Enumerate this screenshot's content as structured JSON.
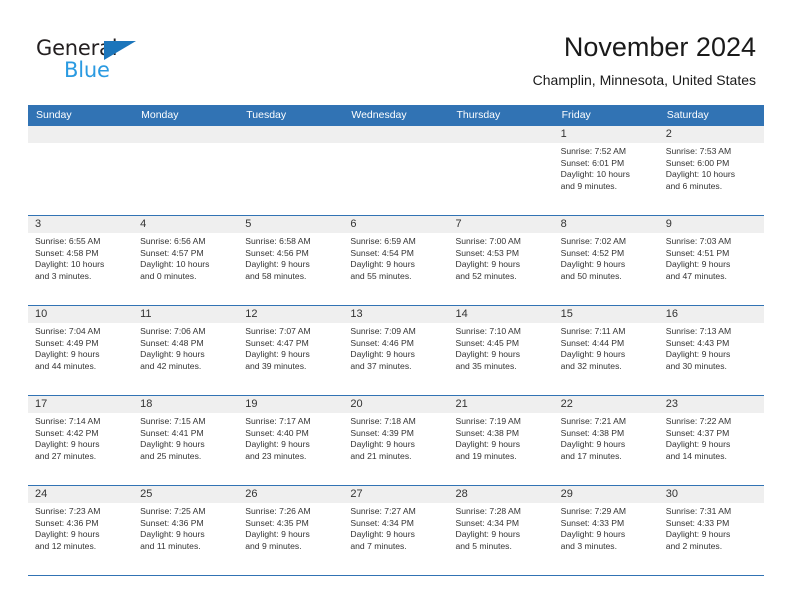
{
  "brand": {
    "name_part1": "General",
    "name_part2": "Blue",
    "triangle_color": "#1b75bb",
    "blue_text_color": "#2a9ae1"
  },
  "header": {
    "title": "November 2024",
    "subtitle": "Champlin, Minnesota, United States"
  },
  "colors": {
    "header_blue": "#3173b4",
    "daynum_band": "#efefef",
    "text": "#333333"
  },
  "weekdays": [
    "Sunday",
    "Monday",
    "Tuesday",
    "Wednesday",
    "Thursday",
    "Friday",
    "Saturday"
  ],
  "weeks": [
    [
      {
        "day": "",
        "empty": true,
        "sunrise": "",
        "sunset": "",
        "daylight1": "",
        "daylight2": ""
      },
      {
        "day": "",
        "empty": true,
        "sunrise": "",
        "sunset": "",
        "daylight1": "",
        "daylight2": ""
      },
      {
        "day": "",
        "empty": true,
        "sunrise": "",
        "sunset": "",
        "daylight1": "",
        "daylight2": ""
      },
      {
        "day": "",
        "empty": true,
        "sunrise": "",
        "sunset": "",
        "daylight1": "",
        "daylight2": ""
      },
      {
        "day": "",
        "empty": true,
        "sunrise": "",
        "sunset": "",
        "daylight1": "",
        "daylight2": ""
      },
      {
        "day": "1",
        "empty": false,
        "sunrise": "Sunrise: 7:52 AM",
        "sunset": "Sunset: 6:01 PM",
        "daylight1": "Daylight: 10 hours",
        "daylight2": "and 9 minutes."
      },
      {
        "day": "2",
        "empty": false,
        "sunrise": "Sunrise: 7:53 AM",
        "sunset": "Sunset: 6:00 PM",
        "daylight1": "Daylight: 10 hours",
        "daylight2": "and 6 minutes."
      }
    ],
    [
      {
        "day": "3",
        "empty": false,
        "sunrise": "Sunrise: 6:55 AM",
        "sunset": "Sunset: 4:58 PM",
        "daylight1": "Daylight: 10 hours",
        "daylight2": "and 3 minutes."
      },
      {
        "day": "4",
        "empty": false,
        "sunrise": "Sunrise: 6:56 AM",
        "sunset": "Sunset: 4:57 PM",
        "daylight1": "Daylight: 10 hours",
        "daylight2": "and 0 minutes."
      },
      {
        "day": "5",
        "empty": false,
        "sunrise": "Sunrise: 6:58 AM",
        "sunset": "Sunset: 4:56 PM",
        "daylight1": "Daylight: 9 hours",
        "daylight2": "and 58 minutes."
      },
      {
        "day": "6",
        "empty": false,
        "sunrise": "Sunrise: 6:59 AM",
        "sunset": "Sunset: 4:54 PM",
        "daylight1": "Daylight: 9 hours",
        "daylight2": "and 55 minutes."
      },
      {
        "day": "7",
        "empty": false,
        "sunrise": "Sunrise: 7:00 AM",
        "sunset": "Sunset: 4:53 PM",
        "daylight1": "Daylight: 9 hours",
        "daylight2": "and 52 minutes."
      },
      {
        "day": "8",
        "empty": false,
        "sunrise": "Sunrise: 7:02 AM",
        "sunset": "Sunset: 4:52 PM",
        "daylight1": "Daylight: 9 hours",
        "daylight2": "and 50 minutes."
      },
      {
        "day": "9",
        "empty": false,
        "sunrise": "Sunrise: 7:03 AM",
        "sunset": "Sunset: 4:51 PM",
        "daylight1": "Daylight: 9 hours",
        "daylight2": "and 47 minutes."
      }
    ],
    [
      {
        "day": "10",
        "empty": false,
        "sunrise": "Sunrise: 7:04 AM",
        "sunset": "Sunset: 4:49 PM",
        "daylight1": "Daylight: 9 hours",
        "daylight2": "and 44 minutes."
      },
      {
        "day": "11",
        "empty": false,
        "sunrise": "Sunrise: 7:06 AM",
        "sunset": "Sunset: 4:48 PM",
        "daylight1": "Daylight: 9 hours",
        "daylight2": "and 42 minutes."
      },
      {
        "day": "12",
        "empty": false,
        "sunrise": "Sunrise: 7:07 AM",
        "sunset": "Sunset: 4:47 PM",
        "daylight1": "Daylight: 9 hours",
        "daylight2": "and 39 minutes."
      },
      {
        "day": "13",
        "empty": false,
        "sunrise": "Sunrise: 7:09 AM",
        "sunset": "Sunset: 4:46 PM",
        "daylight1": "Daylight: 9 hours",
        "daylight2": "and 37 minutes."
      },
      {
        "day": "14",
        "empty": false,
        "sunrise": "Sunrise: 7:10 AM",
        "sunset": "Sunset: 4:45 PM",
        "daylight1": "Daylight: 9 hours",
        "daylight2": "and 35 minutes."
      },
      {
        "day": "15",
        "empty": false,
        "sunrise": "Sunrise: 7:11 AM",
        "sunset": "Sunset: 4:44 PM",
        "daylight1": "Daylight: 9 hours",
        "daylight2": "and 32 minutes."
      },
      {
        "day": "16",
        "empty": false,
        "sunrise": "Sunrise: 7:13 AM",
        "sunset": "Sunset: 4:43 PM",
        "daylight1": "Daylight: 9 hours",
        "daylight2": "and 30 minutes."
      }
    ],
    [
      {
        "day": "17",
        "empty": false,
        "sunrise": "Sunrise: 7:14 AM",
        "sunset": "Sunset: 4:42 PM",
        "daylight1": "Daylight: 9 hours",
        "daylight2": "and 27 minutes."
      },
      {
        "day": "18",
        "empty": false,
        "sunrise": "Sunrise: 7:15 AM",
        "sunset": "Sunset: 4:41 PM",
        "daylight1": "Daylight: 9 hours",
        "daylight2": "and 25 minutes."
      },
      {
        "day": "19",
        "empty": false,
        "sunrise": "Sunrise: 7:17 AM",
        "sunset": "Sunset: 4:40 PM",
        "daylight1": "Daylight: 9 hours",
        "daylight2": "and 23 minutes."
      },
      {
        "day": "20",
        "empty": false,
        "sunrise": "Sunrise: 7:18 AM",
        "sunset": "Sunset: 4:39 PM",
        "daylight1": "Daylight: 9 hours",
        "daylight2": "and 21 minutes."
      },
      {
        "day": "21",
        "empty": false,
        "sunrise": "Sunrise: 7:19 AM",
        "sunset": "Sunset: 4:38 PM",
        "daylight1": "Daylight: 9 hours",
        "daylight2": "and 19 minutes."
      },
      {
        "day": "22",
        "empty": false,
        "sunrise": "Sunrise: 7:21 AM",
        "sunset": "Sunset: 4:38 PM",
        "daylight1": "Daylight: 9 hours",
        "daylight2": "and 17 minutes."
      },
      {
        "day": "23",
        "empty": false,
        "sunrise": "Sunrise: 7:22 AM",
        "sunset": "Sunset: 4:37 PM",
        "daylight1": "Daylight: 9 hours",
        "daylight2": "and 14 minutes."
      }
    ],
    [
      {
        "day": "24",
        "empty": false,
        "sunrise": "Sunrise: 7:23 AM",
        "sunset": "Sunset: 4:36 PM",
        "daylight1": "Daylight: 9 hours",
        "daylight2": "and 12 minutes."
      },
      {
        "day": "25",
        "empty": false,
        "sunrise": "Sunrise: 7:25 AM",
        "sunset": "Sunset: 4:36 PM",
        "daylight1": "Daylight: 9 hours",
        "daylight2": "and 11 minutes."
      },
      {
        "day": "26",
        "empty": false,
        "sunrise": "Sunrise: 7:26 AM",
        "sunset": "Sunset: 4:35 PM",
        "daylight1": "Daylight: 9 hours",
        "daylight2": "and 9 minutes."
      },
      {
        "day": "27",
        "empty": false,
        "sunrise": "Sunrise: 7:27 AM",
        "sunset": "Sunset: 4:34 PM",
        "daylight1": "Daylight: 9 hours",
        "daylight2": "and 7 minutes."
      },
      {
        "day": "28",
        "empty": false,
        "sunrise": "Sunrise: 7:28 AM",
        "sunset": "Sunset: 4:34 PM",
        "daylight1": "Daylight: 9 hours",
        "daylight2": "and 5 minutes."
      },
      {
        "day": "29",
        "empty": false,
        "sunrise": "Sunrise: 7:29 AM",
        "sunset": "Sunset: 4:33 PM",
        "daylight1": "Daylight: 9 hours",
        "daylight2": "and 3 minutes."
      },
      {
        "day": "30",
        "empty": false,
        "sunrise": "Sunrise: 7:31 AM",
        "sunset": "Sunset: 4:33 PM",
        "daylight1": "Daylight: 9 hours",
        "daylight2": "and 2 minutes."
      }
    ]
  ]
}
